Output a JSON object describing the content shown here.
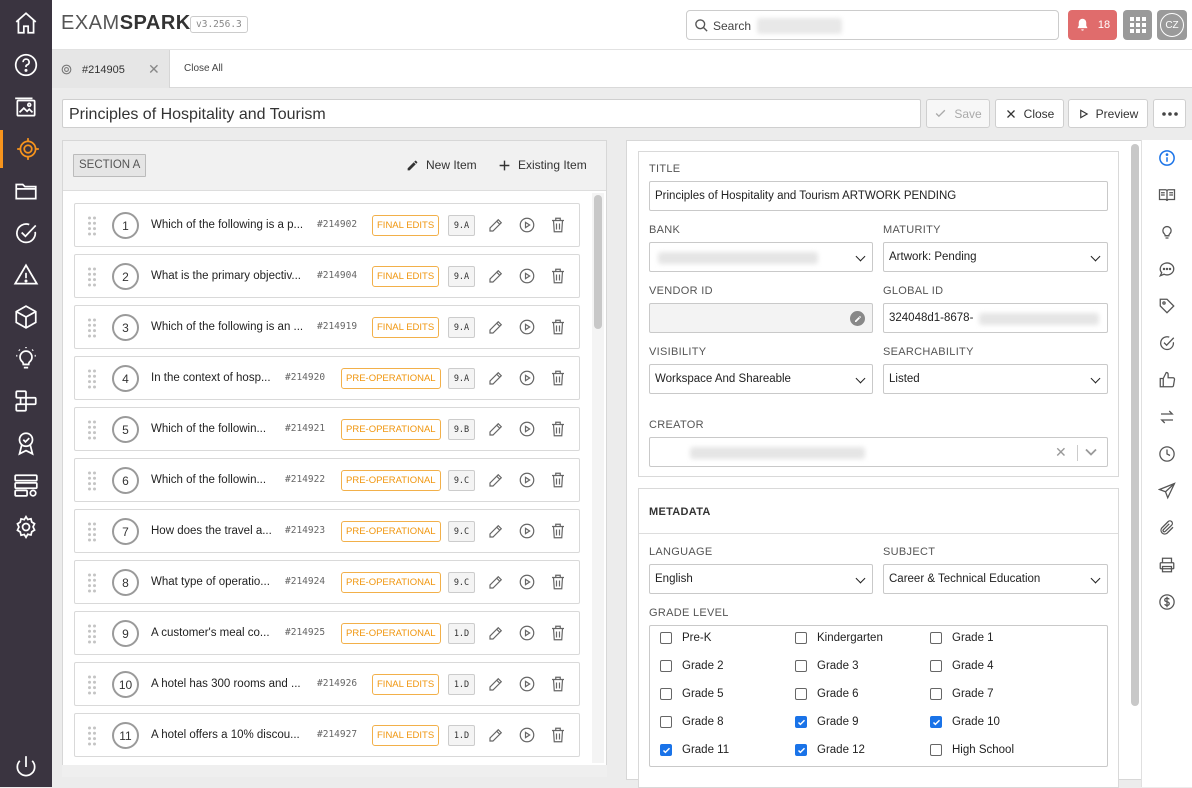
{
  "app": {
    "logo_a": "EXAM",
    "logo_b": "SPARK",
    "version": "v3.256.3"
  },
  "topbar": {
    "search_label": "Search",
    "notifications_count": "18",
    "avatar_initials": "CZ"
  },
  "sidebar": {
    "items": [
      "home-icon",
      "help-icon",
      "gallery-icon",
      "target-icon",
      "folder-icon",
      "check-circle-icon",
      "warning-icon",
      "cube-icon",
      "lightbulb-icon",
      "workflow-icon",
      "badge-icon",
      "server-settings-icon",
      "gear-icon"
    ],
    "bottom": "power-icon",
    "active_index": 3
  },
  "tabs": {
    "items": [
      {
        "label": "#214905",
        "close": "✕"
      }
    ],
    "close_all": "Close All"
  },
  "toolbar": {
    "title_value": "Principles of Hospitality and Tourism",
    "save": "Save",
    "close": "Close",
    "preview": "Preview"
  },
  "section": {
    "label": "SECTION A",
    "new_item": "New Item",
    "existing_item": "Existing Item"
  },
  "items": [
    {
      "n": "1",
      "text": "Which of the following is a p...",
      "id": "#214902",
      "status": "FINAL EDITS",
      "code": "9.A"
    },
    {
      "n": "2",
      "text": "What is the primary objectiv...",
      "id": "#214904",
      "status": "FINAL EDITS",
      "code": "9.A"
    },
    {
      "n": "3",
      "text": "Which of the following is an ...",
      "id": "#214919",
      "status": "FINAL EDITS",
      "code": "9.A"
    },
    {
      "n": "4",
      "text": "In the context of hosp...",
      "id": "#214920",
      "status": "PRE-OPERATIONAL",
      "code": "9.A"
    },
    {
      "n": "5",
      "text": "Which of the followin...",
      "id": "#214921",
      "status": "PRE-OPERATIONAL",
      "code": "9.B"
    },
    {
      "n": "6",
      "text": "Which of the followin...",
      "id": "#214922",
      "status": "PRE-OPERATIONAL",
      "code": "9.C"
    },
    {
      "n": "7",
      "text": "How does the travel a...",
      "id": "#214923",
      "status": "PRE-OPERATIONAL",
      "code": "9.C"
    },
    {
      "n": "8",
      "text": "What type of operatio...",
      "id": "#214924",
      "status": "PRE-OPERATIONAL",
      "code": "9.C"
    },
    {
      "n": "9",
      "text": "A customer's meal co...",
      "id": "#214925",
      "status": "PRE-OPERATIONAL",
      "code": "1.D"
    },
    {
      "n": "10",
      "text": "A hotel has 300 rooms and ...",
      "id": "#214926",
      "status": "FINAL EDITS",
      "code": "1.D"
    },
    {
      "n": "11",
      "text": "A hotel offers a 10% discou...",
      "id": "#214927",
      "status": "FINAL EDITS",
      "code": "1.D"
    }
  ],
  "details": {
    "title_label": "TITLE",
    "title_value": "Principles of Hospitality and Tourism ARTWORK PENDING",
    "bank_label": "BANK",
    "maturity_label": "MATURITY",
    "maturity_value": "Artwork: Pending",
    "vendor_label": "VENDOR ID",
    "global_label": "GLOBAL ID",
    "global_value": "324048d1-8678-",
    "visibility_label": "VISIBILITY",
    "visibility_value": "Workspace And Shareable",
    "searchability_label": "SEARCHABILITY",
    "searchability_value": "Listed",
    "creator_label": "CREATOR",
    "creator_clear": "✕"
  },
  "metadata": {
    "heading": "METADATA",
    "language_label": "LANGUAGE",
    "language_value": "English",
    "subject_label": "SUBJECT",
    "subject_value": "Career & Technical Education",
    "grade_label": "GRADE LEVEL",
    "grades": [
      {
        "label": "Pre-K",
        "checked": false
      },
      {
        "label": "Kindergarten",
        "checked": false
      },
      {
        "label": "Grade 1",
        "checked": false
      },
      {
        "label": "Grade 2",
        "checked": false
      },
      {
        "label": "Grade 3",
        "checked": false
      },
      {
        "label": "Grade 4",
        "checked": false
      },
      {
        "label": "Grade 5",
        "checked": false
      },
      {
        "label": "Grade 6",
        "checked": false
      },
      {
        "label": "Grade 7",
        "checked": false
      },
      {
        "label": "Grade 8",
        "checked": false
      },
      {
        "label": "Grade 9",
        "checked": true
      },
      {
        "label": "Grade 10",
        "checked": true
      },
      {
        "label": "Grade 11",
        "checked": true
      },
      {
        "label": "Grade 12",
        "checked": true
      },
      {
        "label": "High School",
        "checked": false
      }
    ]
  },
  "rail": {
    "items": [
      "info-icon",
      "book-icon",
      "lightbulb-icon",
      "comment-icon",
      "tag-icon",
      "check-circle-icon",
      "thumbs-up-icon",
      "transfer-icon",
      "clock-icon",
      "send-icon",
      "paperclip-icon",
      "print-icon",
      "dollar-icon"
    ],
    "active_index": 0
  },
  "colors": {
    "accent": "#f7941d",
    "sidebar": "#3a3440",
    "badge": "#f0960e",
    "notif": "#e06c6c",
    "check": "#1a73e8"
  }
}
